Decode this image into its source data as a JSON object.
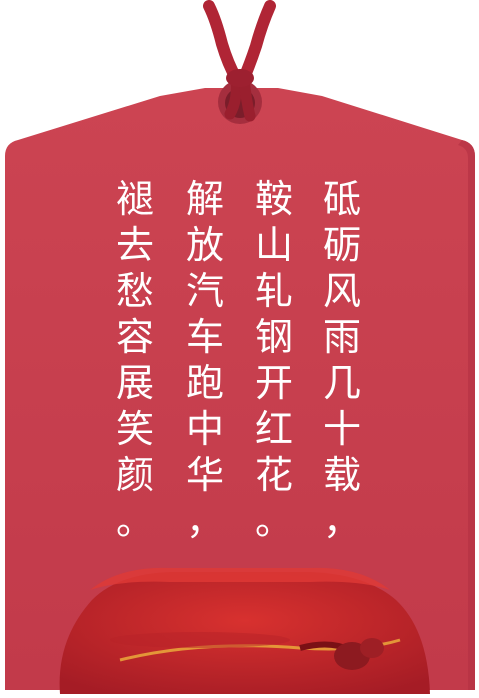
{
  "poem": {
    "columns": [
      "砥砺风雨几十载，",
      "鞍山轧钢开红花。",
      "解放汽车跑中华，",
      "褪去愁容展笑颜。"
    ]
  },
  "colors": {
    "tag": "#c8404f",
    "tag_shadow": "#b23042",
    "string": "#b02535",
    "bag": "#c9262c",
    "bag_dark": "#9c1b22",
    "text": "#ffffff"
  },
  "icons": {
    "tag": "wooden-tag",
    "string": "hanging-string",
    "bag": "lucky-bag"
  }
}
